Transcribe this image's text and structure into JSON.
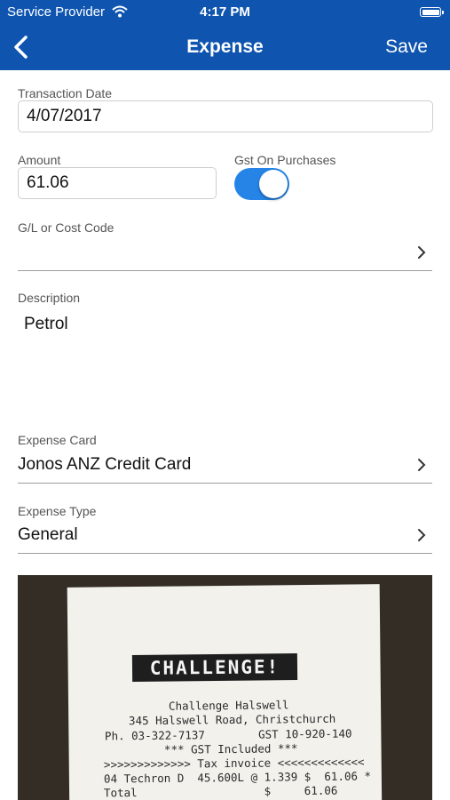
{
  "status_bar": {
    "carrier": "Service Provider",
    "time": "4:17 PM"
  },
  "nav": {
    "title": "Expense",
    "save_label": "Save"
  },
  "form": {
    "transaction_date": {
      "label": "Transaction Date",
      "value": "4/07/2017"
    },
    "amount": {
      "label": "Amount",
      "value": "61.06"
    },
    "gst": {
      "label": "Gst On Purchases",
      "enabled": true
    },
    "gl_code": {
      "label": "G/L or Cost Code",
      "value": ""
    },
    "description": {
      "label": "Description",
      "value": "Petrol"
    },
    "expense_card": {
      "label": "Expense Card",
      "value": "Jonos ANZ Credit Card"
    },
    "expense_type": {
      "label": "Expense Type",
      "value": "General"
    }
  },
  "receipt": {
    "logo": "CHALLENGE!",
    "lines": [
      "Challenge Halswell",
      "345 Halswell Road, Christchurch",
      "Ph. 03-322-7137        GST 10-920-140",
      "*** GST Included ***",
      ">>>>>>>>>>>>> Tax invoice <<<<<<<<<<<<<",
      "04 Techron D  45.600L @ 1.339 $  61.06 *",
      "Total                   $     61.06"
    ]
  },
  "colors": {
    "header": "#0f55b0",
    "toggle_on": "#2584e6"
  }
}
